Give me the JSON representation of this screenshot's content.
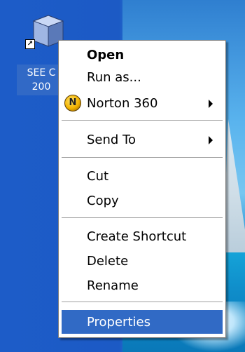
{
  "desktop": {
    "icon": {
      "name": "SEE C 200",
      "label_line1": "SEE C",
      "label_line2": "200",
      "shortcut_glyph": "↗"
    }
  },
  "context_menu": {
    "items": [
      {
        "label": "Open",
        "bold": true
      },
      {
        "label": "Run as..."
      },
      {
        "label": "Norton 360",
        "icon": "norton-icon",
        "icon_glyph": "N",
        "submenu": true
      },
      {
        "label": "Send To",
        "submenu": true
      },
      {
        "label": "Cut"
      },
      {
        "label": "Copy"
      },
      {
        "label": "Create Shortcut"
      },
      {
        "label": "Delete"
      },
      {
        "label": "Rename"
      },
      {
        "label": "Properties",
        "selected": true
      }
    ]
  },
  "colors": {
    "selection": "#316ac5",
    "desktop_blue": "#1c5ac5",
    "menu_border": "#808080"
  }
}
